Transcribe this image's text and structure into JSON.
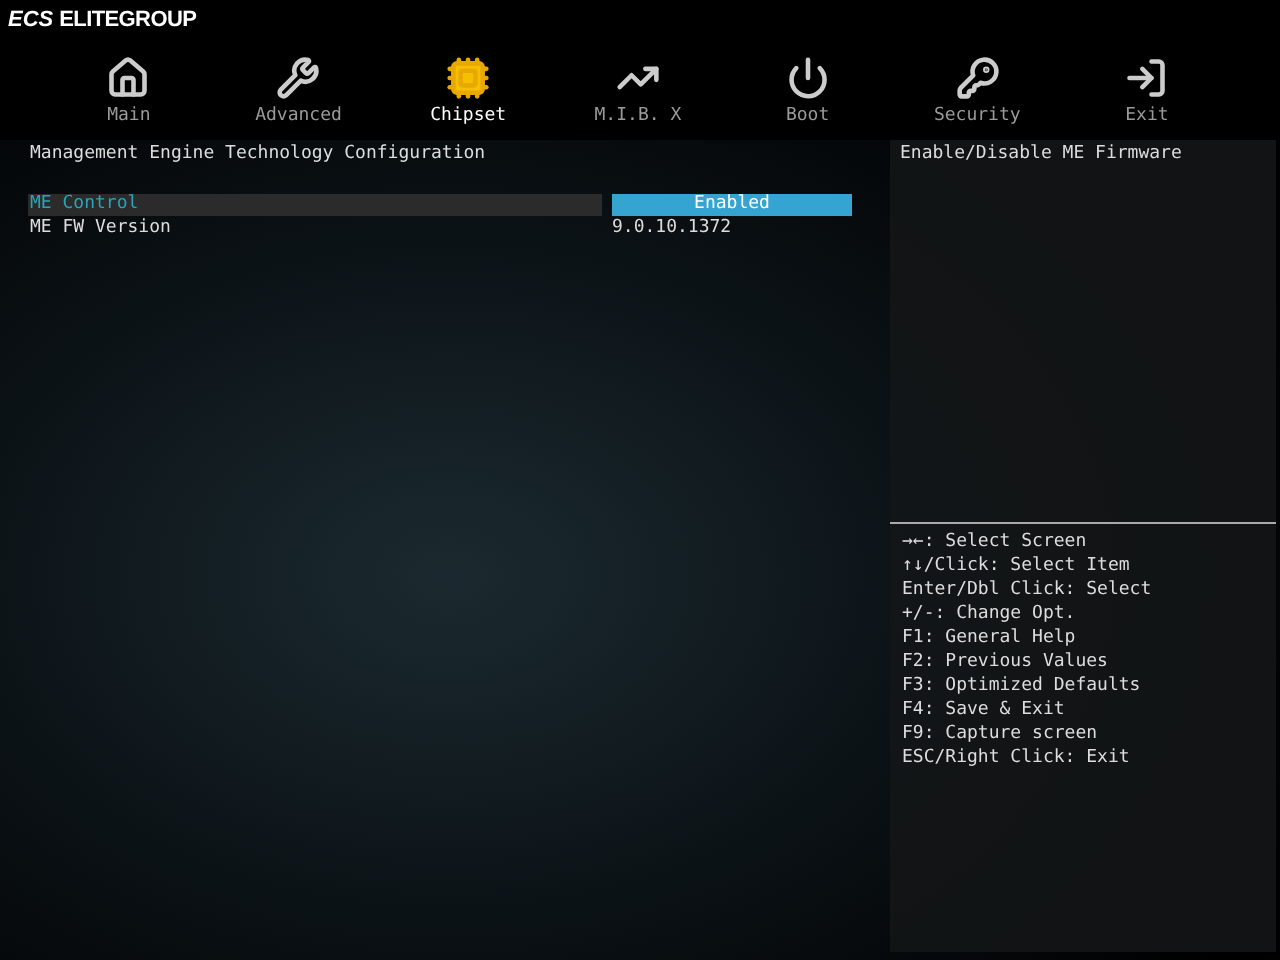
{
  "brand": {
    "mark": "ECS",
    "name": "ELITEGROUP"
  },
  "tabs": [
    {
      "label": "Main",
      "kind": "home",
      "selected": false
    },
    {
      "label": "Advanced",
      "kind": "wrench",
      "selected": false
    },
    {
      "label": "Chipset",
      "kind": "chip",
      "selected": true
    },
    {
      "label": "M.I.B. X",
      "kind": "chart",
      "selected": false
    },
    {
      "label": "Boot",
      "kind": "power",
      "selected": false
    },
    {
      "label": "Security",
      "kind": "key",
      "selected": false
    },
    {
      "label": "Exit",
      "kind": "exit",
      "selected": false
    }
  ],
  "section_title": "Management Engine Technology Configuration",
  "settings": [
    {
      "label": "ME Control",
      "value": "Enabled",
      "selected": true
    },
    {
      "label": "ME FW Version",
      "value": "9.0.10.1372",
      "selected": false
    }
  ],
  "help_text": "Enable/Disable ME Firmware",
  "key_help": [
    "→←: Select Screen",
    "↑↓/Click: Select Item",
    "Enter/Dbl Click: Select",
    "+/-: Change Opt.",
    "F1: General Help",
    "F2: Previous Values",
    "F3: Optimized Defaults",
    "F4: Save & Exit",
    "F9: Capture screen",
    "ESC/Right Click: Exit"
  ]
}
